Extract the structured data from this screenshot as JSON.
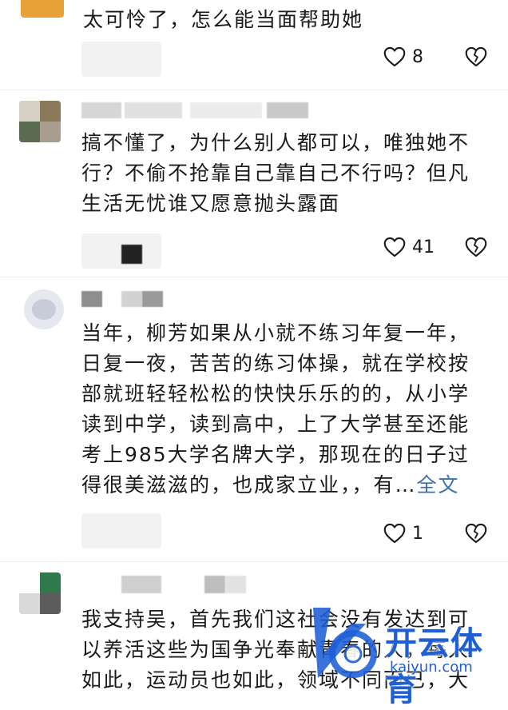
{
  "comments": [
    {
      "text": "太可怜了，怎么能当面帮助她",
      "likes": "8"
    },
    {
      "text": "搞不懂了，为什么别人都可以，唯独她不行？不偷不抢靠自己靠自己不行吗？但凡生活无忧谁又愿意抛头露面",
      "likes": "41"
    },
    {
      "text": "当年，柳芳如果从小就不练习年复一年，日复一夜，苦苦的练习体操，就在学校按部就班轻轻松松的快快乐乐的的，从小学读到中学，读到高中，上了大学甚至还能考上985大学名牌大学，那现在的日子过得很美滋滋的，也成家立业，，有…",
      "more_label": "全文",
      "likes": "1"
    },
    {
      "text": "我支持吴，首先我们这社会没有发达到可以养活这些为国争光奉献青春的人，每人如此，运动员也如此，领域不同而已，大"
    }
  ],
  "watermark": {
    "main": "开云体育",
    "sub": "kaiyun.com"
  },
  "colors": {
    "accent_link": "#3a6fb0",
    "watermark_blue": "#1f5fd6"
  },
  "icons": {
    "like": "heart-outline-icon",
    "dislike": "broken-heart-icon"
  }
}
